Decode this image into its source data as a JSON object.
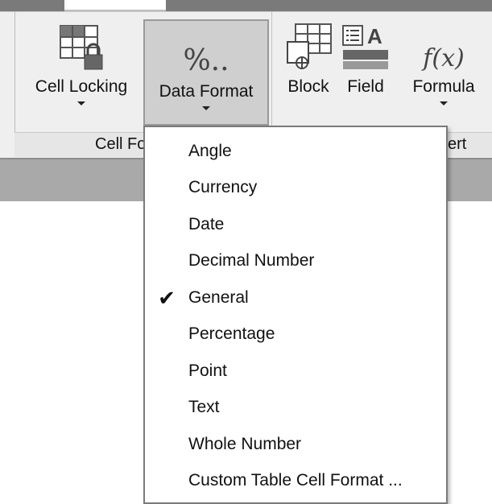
{
  "ribbon": {
    "buttons": {
      "cell_locking": "Cell Locking",
      "data_format": "Data Format",
      "block": "Block",
      "field": "Field",
      "formula": "Formula"
    },
    "icons": {
      "data_format_glyph": "%..",
      "formula_glyph": "f(x)"
    },
    "group_labels": {
      "left": "Cell Fo",
      "right": "ert"
    }
  },
  "menu": {
    "items": [
      {
        "label": "Angle",
        "checked": false
      },
      {
        "label": "Currency",
        "checked": false
      },
      {
        "label": "Date",
        "checked": false
      },
      {
        "label": "Decimal Number",
        "checked": false
      },
      {
        "label": "General",
        "checked": true,
        "check_mark": "✔"
      },
      {
        "label": "Percentage",
        "checked": false
      },
      {
        "label": "Point",
        "checked": false
      },
      {
        "label": "Text",
        "checked": false
      },
      {
        "label": "Whole Number",
        "checked": false
      },
      {
        "label": "Custom Table Cell Format ...",
        "checked": false
      }
    ]
  }
}
